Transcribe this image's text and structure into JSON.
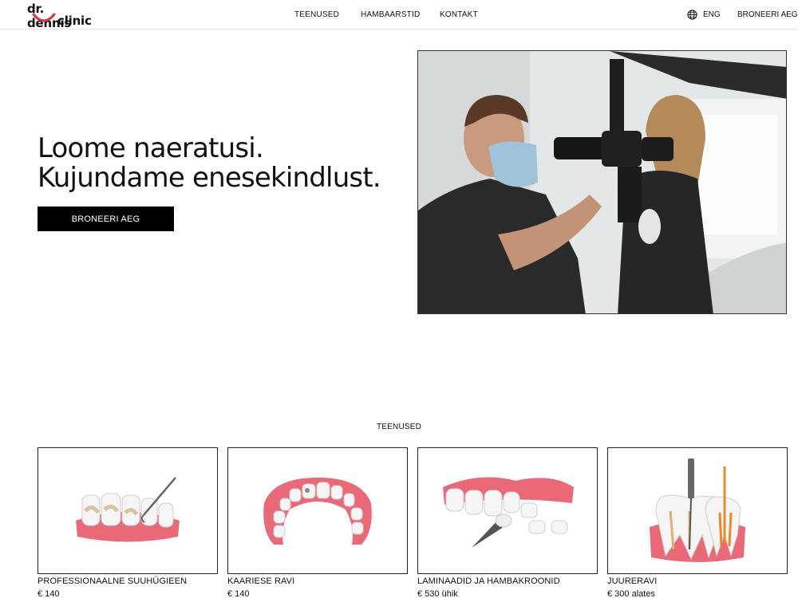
{
  "header": {
    "logo": {
      "line1": "dr. dennis",
      "line2": "clinic"
    },
    "nav": [
      {
        "label": "TEENUSED"
      },
      {
        "label": "HAMBAARSTID"
      },
      {
        "label": "KONTAKT"
      }
    ],
    "language": {
      "label": "ENG",
      "icon": "globe-icon"
    },
    "book_label": "BRONEERI AEG"
  },
  "hero": {
    "title_line1": "Loome naeratusi.",
    "title_line2": "Kujundame enesekindlust.",
    "button_label": "BRONEERI AEG"
  },
  "services": {
    "section_label": "TEENUSED",
    "items": [
      {
        "name": "PROFESSIONAALNE SUUHÜGIEEN",
        "price": "€ 140"
      },
      {
        "name": "KAARIESE RAVI",
        "price": "€ 140"
      },
      {
        "name": "LAMINAADID JA HAMBAKROONID",
        "price": "€ 530 ühik"
      },
      {
        "name": "JUURERAVI",
        "price": "€ 300 alates"
      }
    ]
  },
  "colors": {
    "accent": "#d9334a",
    "gum": "#e86a78",
    "button": "#000000"
  }
}
